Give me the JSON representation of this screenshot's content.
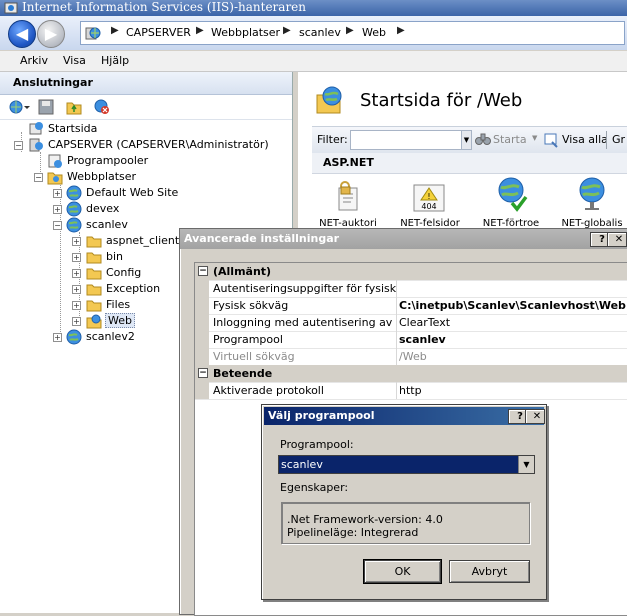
{
  "window": {
    "title": "Internet Information Services (IIS)-hanteraren"
  },
  "breadcrumbs": [
    "CAPSERVER",
    "Webbplatser",
    "scanlev",
    "Web"
  ],
  "menu": [
    "Arkiv",
    "Visa",
    "Hjälp"
  ],
  "connections": {
    "header": "Anslutningar",
    "tree": [
      {
        "label": "Startsida"
      },
      {
        "label": "CAPSERVER (CAPSERVER\\Administratör)",
        "expander": "−"
      },
      {
        "label": "Programpooler"
      },
      {
        "label": "Webbplatser",
        "expander": "−"
      },
      {
        "label": "Default Web Site",
        "expander": "+"
      },
      {
        "label": "devex",
        "expander": "+"
      },
      {
        "label": "scanlev",
        "expander": "−"
      },
      {
        "label": "aspnet_client",
        "expander": "+"
      },
      {
        "label": "bin",
        "expander": "+"
      },
      {
        "label": "Config",
        "expander": "+"
      },
      {
        "label": "Exception",
        "expander": "+"
      },
      {
        "label": "Files",
        "expander": "+"
      },
      {
        "label": "Web",
        "expander": "+"
      },
      {
        "label": "scanlev2",
        "expander": "+"
      }
    ]
  },
  "main": {
    "title": "Startsida för /Web",
    "filter_label": "Filter:",
    "start_label": "Starta",
    "show_all_label": "Visa alla",
    "group_label": "Gr",
    "section_label": "ASP.NET",
    "features": [
      {
        "label": "NET-auktori",
        "icon": "authorization-icon"
      },
      {
        "label": "NET-felsidor",
        "icon": "error-pages-icon",
        "badge": "404"
      },
      {
        "label": "NET-förtroe",
        "icon": "trust-levels-icon"
      },
      {
        "label": "NET-globalis",
        "icon": "globalization-icon"
      }
    ]
  },
  "advanced_dialog": {
    "title": "Avancerade inställningar",
    "help_button": "?",
    "close_button": "✕",
    "categories": [
      {
        "name": "(Allmänt)",
        "toggle": "−",
        "properties": [
          {
            "name": "Autentiseringsuppgifter för fysisk sökv",
            "value": ""
          },
          {
            "name": "Fysisk sökväg",
            "value": "C:\\inetpub\\Scanlev\\Scanlevhost\\Web"
          },
          {
            "name": "Inloggning med autentisering av typer",
            "value": "ClearText"
          },
          {
            "name": "Programpool",
            "value": "scanlev"
          },
          {
            "name": "Virtuell sökväg",
            "value": "/Web"
          }
        ]
      },
      {
        "name": "Beteende",
        "toggle": "−",
        "properties": [
          {
            "name": "Aktiverade protokoll",
            "value": "http"
          }
        ]
      }
    ]
  },
  "pool_dialog": {
    "title": "Välj programpool",
    "help_button": "?",
    "close_button": "✕",
    "pool_label": "Programpool:",
    "selected_pool": "scanlev",
    "dropdown_arrow": "▼",
    "properties_label": "Egenskaper:",
    "framework_line": ".Net Framework-version: 4.0",
    "pipeline_line": "Pipelineläge: Integrerad",
    "ok_label": "OK",
    "cancel_label": "Avbryt"
  }
}
